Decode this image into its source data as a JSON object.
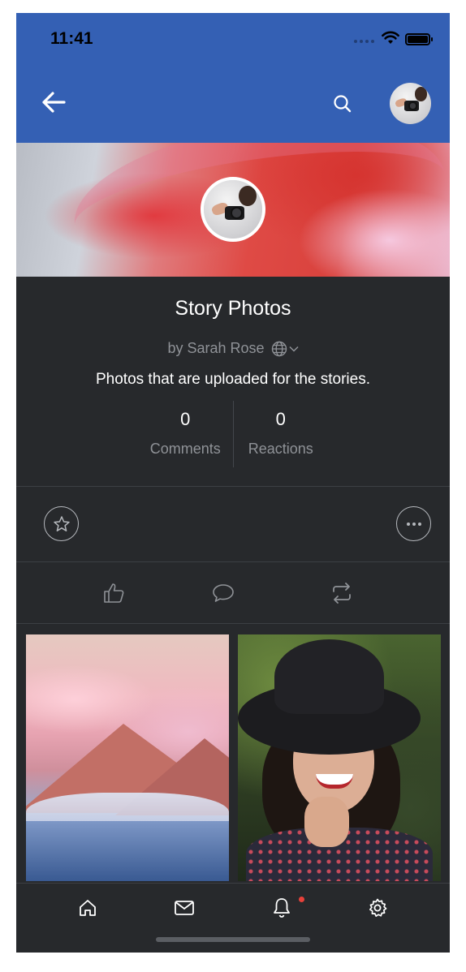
{
  "status_bar": {
    "time": "11:41"
  },
  "nav": {
    "back_icon": "arrow-left-icon",
    "search_icon": "search-icon"
  },
  "album": {
    "title": "Story Photos",
    "author": "by Sarah Rose",
    "description": "Photos that are uploaded for the stories.",
    "privacy_icon": "globe-icon"
  },
  "stats": [
    {
      "value": "0",
      "label": "Comments"
    },
    {
      "value": "0",
      "label": "Reactions"
    }
  ],
  "actions": {
    "favorite_icon": "star-icon",
    "more_icon": "more-icon",
    "like_icon": "thumbs-up-icon",
    "comment_icon": "comment-icon",
    "share_icon": "repost-icon"
  },
  "tabbar": {
    "items": [
      "home-icon",
      "mail-icon",
      "bell-icon",
      "gear-icon"
    ],
    "notification_dot": true
  },
  "colors": {
    "header": "#3460b4",
    "background": "#27292c",
    "notification": "#e8413a"
  }
}
